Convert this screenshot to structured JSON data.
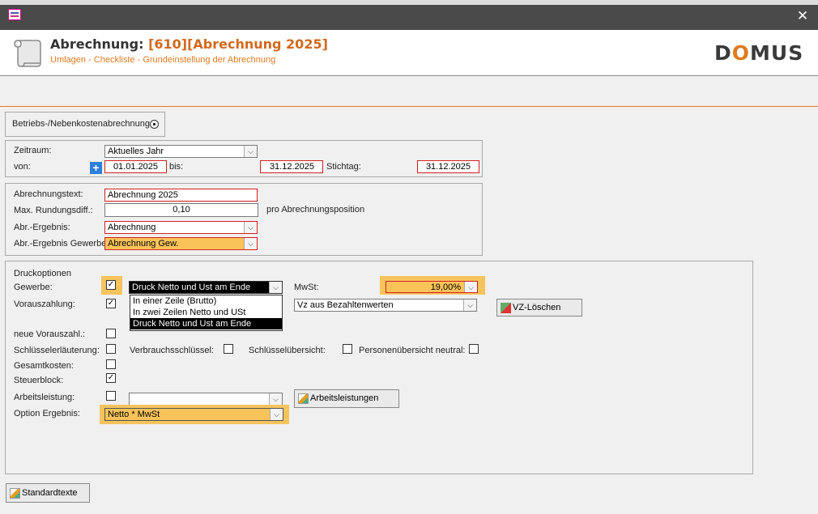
{
  "window": {
    "close_glyph": "✕"
  },
  "header": {
    "title_prefix": "Abrechnung:",
    "title_value": "[610][Abrechnung 2025]",
    "subtitle": "Umlagen - Checkliste - Grundeinstellung der Abrechnung",
    "logo_pre": "D",
    "logo_o": "O",
    "logo_post": "MUS"
  },
  "mode": {
    "label": "Betriebs-/Nebenkostenabrechnung"
  },
  "zeitraum": {
    "label": "Zeitraum:",
    "value": "Aktuelles Jahr",
    "von_label": "von:",
    "von_value": "01.01.2025",
    "bis_label": "bis:",
    "bis_value": "31.12.2025",
    "stichtag_label": "Stichtag:",
    "stichtag_value": "31.12.2025"
  },
  "abrechnung": {
    "text_label": "Abrechnungstext:",
    "text_value": "Abrechnung 2025",
    "rundung_label": "Max. Rundungsdiff.:",
    "rundung_value": "0,10",
    "rundung_suffix": "pro Abrechnungsposition",
    "ergebnis_label": "Abr.-Ergebnis:",
    "ergebnis_value": "Abrechnung",
    "ergebnis_gew_label": "Abr.-Ergebnis Gewerbe:",
    "ergebnis_gew_value": "Abrechnung Gew."
  },
  "druck": {
    "section_label": "Druckoptionen",
    "gewerbe_label": "Gewerbe:",
    "gewerbe_checked": true,
    "gewerbe_select": "Druck Netto und  Ust am Ende",
    "gewerbe_options": [
      "In einer Zeile  (Brutto)",
      "In zwei Zeilen Netto und USt",
      "Druck Netto und  Ust am Ende"
    ],
    "mwst_label": "MwSt:",
    "mwst_value": "19,00%",
    "vorauszahlung_label": "Vorauszahlung:",
    "vorauszahlung_checked": true,
    "vz_select": "Vz aus Bezahltenwerten",
    "vz_loeschen": "VZ-Löschen",
    "neue_vz_label": "neue Vorauszahl.:",
    "schluessel_label": "Schlüsselerläuterung:",
    "verbrauch_label": "Verbrauchsschlüssel:",
    "schluesseluebersicht_label": "Schlüsselübersicht:",
    "personen_label": "Personenübersicht neutral:",
    "gesamtkosten_label": "Gesamtkosten:",
    "steuerblock_label": "Steuerblock:",
    "steuerblock_checked": true,
    "arbeitsleistung_label": "Arbeitsleistung:",
    "arbeitsleistung_value": "",
    "arbeitsleistungen_btn": "Arbeitsleistungen",
    "option_ergebnis_label": "Option Ergebnis:",
    "option_ergebnis_value": "Netto * MwSt"
  },
  "footer": {
    "standardtexte": "Standardtexte"
  },
  "colors": {
    "accent": "#e07b20",
    "highlight": "#f7c35d",
    "required_border": "#d42020"
  }
}
